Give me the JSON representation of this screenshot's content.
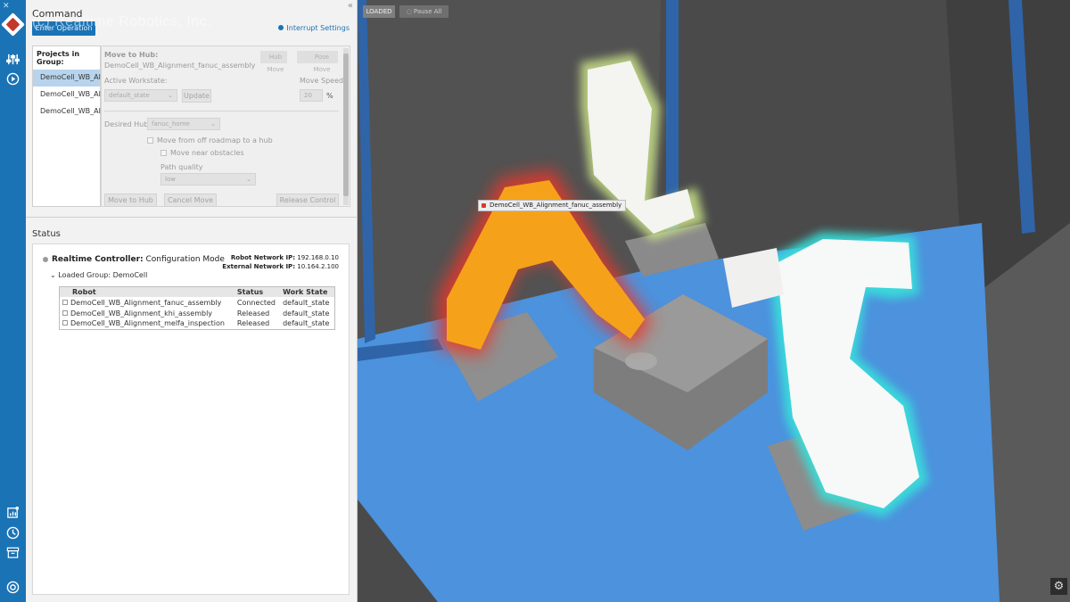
{
  "app": {
    "company_name": "(c) Realtime Robotics, Inc.",
    "collapse_glyph": "«",
    "rail_top_glyph": "✕"
  },
  "command": {
    "title": "Command",
    "enter_operation": "Enter Operation",
    "interrupt_settings": "Interrupt Settings",
    "projects_header": "Projects in Group:",
    "projects": [
      "DemoCell_WB_Alignment_fanuc_assembly",
      "DemoCell_WB_Alignment_khi_assembly",
      "DemoCell_WB_Alignment_melfa_inspection"
    ],
    "move_to_hub_label": "Move to Hub:",
    "move_to_hub_project": "DemoCell_WB_Alignment_fanuc_assembly",
    "hub_move": "Hub\nMove",
    "pose_move": "Pose\nMove",
    "active_workstate_label": "Active Workstate:",
    "active_workstate_value": "default_state",
    "update_button": "Update",
    "move_speed_label": "Move Speed:",
    "move_speed_value": "20",
    "move_speed_unit": "%",
    "desired_hub_label": "Desired Hub:",
    "desired_hub_value": "fanuc_home",
    "move_from_off_roadmap": "Move from off roadmap to a hub",
    "move_near_obstacles": "Move near obstacles",
    "path_quality_label": "Path quality",
    "path_quality_value": "low",
    "move_to_hub_button": "Move to Hub",
    "cancel_move_button": "Cancel Move",
    "release_control_button": "Release Control"
  },
  "status": {
    "title": "Status",
    "controller_label": "Realtime Controller:",
    "controller_mode": "Configuration Mode",
    "robot_ip_label": "Robot Network IP:",
    "robot_ip": "192.168.0.10",
    "external_ip_label": "External Network IP:",
    "external_ip": "10.164.2.100",
    "loaded_group": "Loaded Group: DemoCell",
    "columns": [
      "Robot",
      "Status",
      "Work State"
    ],
    "rows": [
      {
        "robot": "DemoCell_WB_Alignment_fanuc_assembly",
        "status": "Connected",
        "work_state": "default_state"
      },
      {
        "robot": "DemoCell_WB_Alignment_khi_assembly",
        "status": "Released",
        "work_state": "default_state"
      },
      {
        "robot": "DemoCell_WB_Alignment_melfa_inspection",
        "status": "Released",
        "work_state": "default_state"
      }
    ]
  },
  "viewport": {
    "loaded_tag": "LOADED",
    "pause_all": "Pause All",
    "robot_label": "DemoCell_WB_Alignment_fanuc_assembly",
    "colors": {
      "floor": "#4c92dd",
      "wall": "#555555",
      "beam": "#2f64a8",
      "fanuc": "#f5a21a",
      "fanuc_glow": "#e8392a",
      "khi_glow": "#cfe88a",
      "melfa_glow": "#38e0da"
    }
  }
}
